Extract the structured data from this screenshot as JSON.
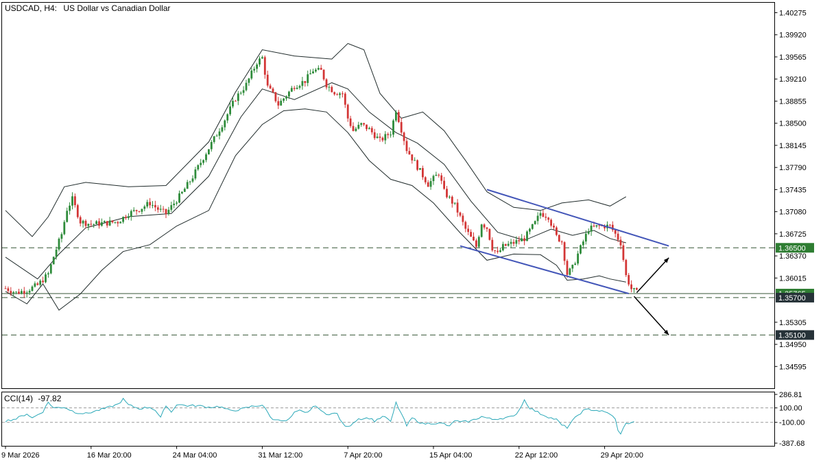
{
  "header": {
    "symbol": "USDCAD, H4:",
    "description": "US Dollar vs Canadian Dollar"
  },
  "colors": {
    "bull": "#2e8b3a",
    "bear": "#d33535",
    "band": "#1f2a2a",
    "channel": "#4255b8",
    "level_line": "#355535",
    "cci": "#2aa8b8",
    "tag_green": "#2e7d32",
    "tag_dark": "#263238",
    "grid": "#000000"
  },
  "chart_data": [
    {
      "type": "candlestick",
      "title": "USDCAD, H4:  US Dollar vs Canadian Dollar",
      "ylim": [
        1.3424,
        1.4044
      ],
      "y_ticks": [
        "1.40275",
        "1.39920",
        "1.39565",
        "1.39210",
        "1.38855",
        "1.38500",
        "1.38145",
        "1.37790",
        "1.37435",
        "1.37080",
        "1.36725",
        "1.36370",
        "1.36015",
        "1.35305",
        "1.34950",
        "1.34595"
      ],
      "x_ticks": [
        {
          "label": "9 Mar 2026",
          "index": 0
        },
        {
          "label": "16 Mar 20:00",
          "index": 32
        },
        {
          "label": "24 Mar 04:00",
          "index": 64
        },
        {
          "label": "31 Mar 12:00",
          "index": 96
        },
        {
          "label": "7 Apr 20:00",
          "index": 128
        },
        {
          "label": "15 Apr 04:00",
          "index": 160
        },
        {
          "label": "22 Apr 12:00",
          "index": 192
        },
        {
          "label": "29 Apr 20:00",
          "index": 224
        }
      ],
      "anchors": [
        [
          0,
          1.3585
        ],
        [
          4,
          1.3578
        ],
        [
          8,
          1.3582
        ],
        [
          12,
          1.359
        ],
        [
          16,
          1.3608
        ],
        [
          18,
          1.3636
        ],
        [
          21,
          1.3672
        ],
        [
          23,
          1.3712
        ],
        [
          25,
          1.3728
        ],
        [
          28,
          1.3692
        ],
        [
          32,
          1.3688
        ],
        [
          38,
          1.369
        ],
        [
          42,
          1.3692
        ],
        [
          46,
          1.3705
        ],
        [
          50,
          1.3712
        ],
        [
          54,
          1.3722
        ],
        [
          57,
          1.3712
        ],
        [
          60,
          1.3705
        ],
        [
          62,
          1.3716
        ],
        [
          66,
          1.3738
        ],
        [
          70,
          1.3764
        ],
        [
          74,
          1.3795
        ],
        [
          78,
          1.3825
        ],
        [
          82,
          1.3856
        ],
        [
          86,
          1.389
        ],
        [
          90,
          1.3912
        ],
        [
          94,
          1.3948
        ],
        [
          96,
          1.3955
        ],
        [
          98,
          1.3908
        ],
        [
          100,
          1.3896
        ],
        [
          102,
          1.388
        ],
        [
          105,
          1.3895
        ],
        [
          108,
          1.391
        ],
        [
          112,
          1.3918
        ],
        [
          115,
          1.3935
        ],
        [
          118,
          1.3934
        ],
        [
          120,
          1.3912
        ],
        [
          123,
          1.39
        ],
        [
          126,
          1.3898
        ],
        [
          128,
          1.3858
        ],
        [
          130,
          1.3838
        ],
        [
          133,
          1.3848
        ],
        [
          136,
          1.384
        ],
        [
          140,
          1.3822
        ],
        [
          144,
          1.3835
        ],
        [
          146,
          1.3872
        ],
        [
          148,
          1.384
        ],
        [
          150,
          1.3808
        ],
        [
          154,
          1.378
        ],
        [
          158,
          1.3752
        ],
        [
          162,
          1.377
        ],
        [
          164,
          1.374
        ],
        [
          168,
          1.3718
        ],
        [
          172,
          1.368
        ],
        [
          176,
          1.3652
        ],
        [
          178,
          1.369
        ],
        [
          180,
          1.3682
        ],
        [
          182,
          1.365
        ],
        [
          184,
          1.364
        ],
        [
          186,
          1.3652
        ],
        [
          190,
          1.3658
        ],
        [
          194,
          1.3665
        ],
        [
          198,
          1.369
        ],
        [
          200,
          1.3706
        ],
        [
          203,
          1.37
        ],
        [
          206,
          1.3668
        ],
        [
          208,
          1.366
        ],
        [
          210,
          1.3608
        ],
        [
          212,
          1.3618
        ],
        [
          214,
          1.364
        ],
        [
          216,
          1.366
        ],
        [
          218,
          1.368
        ],
        [
          222,
          1.3685
        ],
        [
          226,
          1.3685
        ],
        [
          228,
          1.3672
        ],
        [
          230,
          1.3658
        ],
        [
          232,
          1.3605
        ],
        [
          234,
          1.3584
        ],
        [
          236,
          1.3578
        ]
      ],
      "bollinger": {
        "upper": [
          [
            0,
            1.371
          ],
          [
            10,
            1.3668
          ],
          [
            16,
            1.37
          ],
          [
            22,
            1.3748
          ],
          [
            30,
            1.3755
          ],
          [
            46,
            1.3748
          ],
          [
            60,
            1.375
          ],
          [
            76,
            1.382
          ],
          [
            86,
            1.39
          ],
          [
            96,
            1.3968
          ],
          [
            108,
            1.3958
          ],
          [
            122,
            1.3953
          ],
          [
            128,
            1.3978
          ],
          [
            134,
            1.3968
          ],
          [
            140,
            1.3898
          ],
          [
            148,
            1.3858
          ],
          [
            156,
            1.3868
          ],
          [
            164,
            1.3838
          ],
          [
            172,
            1.379
          ],
          [
            180,
            1.374
          ],
          [
            190,
            1.3715
          ],
          [
            200,
            1.371
          ],
          [
            208,
            1.3722
          ],
          [
            218,
            1.3727
          ],
          [
            226,
            1.3717
          ],
          [
            232,
            1.3732
          ]
        ],
        "middle": [
          [
            0,
            1.3635
          ],
          [
            12,
            1.36
          ],
          [
            20,
            1.364
          ],
          [
            30,
            1.3682
          ],
          [
            46,
            1.37
          ],
          [
            62,
            1.3705
          ],
          [
            76,
            1.3765
          ],
          [
            88,
            1.386
          ],
          [
            96,
            1.3905
          ],
          [
            108,
            1.3888
          ],
          [
            122,
            1.3915
          ],
          [
            128,
            1.3905
          ],
          [
            136,
            1.3868
          ],
          [
            146,
            1.3835
          ],
          [
            154,
            1.3818
          ],
          [
            164,
            1.3784
          ],
          [
            174,
            1.3725
          ],
          [
            184,
            1.3675
          ],
          [
            194,
            1.3662
          ],
          [
            204,
            1.368
          ],
          [
            212,
            1.367
          ],
          [
            220,
            1.3678
          ],
          [
            226,
            1.3665
          ],
          [
            232,
            1.3658
          ]
        ],
        "lower": [
          [
            0,
            1.358
          ],
          [
            8,
            1.356
          ],
          [
            14,
            1.3592
          ],
          [
            20,
            1.355
          ],
          [
            28,
            1.3576
          ],
          [
            36,
            1.3614
          ],
          [
            44,
            1.3644
          ],
          [
            54,
            1.3655
          ],
          [
            64,
            1.3685
          ],
          [
            76,
            1.371
          ],
          [
            86,
            1.3798
          ],
          [
            96,
            1.3848
          ],
          [
            104,
            1.387
          ],
          [
            112,
            1.3873
          ],
          [
            120,
            1.3868
          ],
          [
            128,
            1.3835
          ],
          [
            136,
            1.379
          ],
          [
            144,
            1.376
          ],
          [
            152,
            1.375
          ],
          [
            160,
            1.3722
          ],
          [
            170,
            1.3674
          ],
          [
            180,
            1.363
          ],
          [
            190,
            1.364
          ],
          [
            200,
            1.3639
          ],
          [
            206,
            1.3622
          ],
          [
            210,
            1.3598
          ],
          [
            216,
            1.36
          ],
          [
            222,
            1.3605
          ],
          [
            226,
            1.36
          ],
          [
            232,
            1.3595
          ]
        ]
      },
      "channel": {
        "upper": [
          [
            180,
            1.37435
          ],
          [
            248,
            1.3653
          ]
        ],
        "lower": [
          [
            170,
            1.3653
          ],
          [
            233,
            1.35765
          ]
        ]
      },
      "price_lines": [
        {
          "price": 1.365,
          "label": "1.36500",
          "style": "dashed",
          "tag": "tag_green"
        },
        {
          "price": 1.35765,
          "label": "1.35765",
          "style": "solid",
          "tag": "tag_green"
        },
        {
          "price": 1.357,
          "label": "1.35700",
          "style": "dashed",
          "tag": "tag_dark"
        },
        {
          "price": 1.351,
          "label": "1.35100",
          "style": "dashed",
          "tag": "tag_dark"
        }
      ],
      "arrows": [
        {
          "from": [
            236,
            1.3578
          ],
          "to": [
            248,
            1.3634
          ]
        },
        {
          "from": [
            235,
            1.3572
          ],
          "to": [
            248,
            1.351
          ]
        }
      ]
    },
    {
      "type": "line",
      "title": "CCI(14) -97.82",
      "indicator_label": "CCI(14)",
      "current_value": "-97.82",
      "ylim": [
        -430,
        320
      ],
      "y_ticks": [
        "286.81",
        "100.00",
        "-100.00",
        "-387.68"
      ],
      "levels": [
        100,
        -100
      ],
      "anchors": [
        [
          0,
          -80
        ],
        [
          4,
          -50
        ],
        [
          8,
          20
        ],
        [
          10,
          -40
        ],
        [
          14,
          50
        ],
        [
          16,
          180
        ],
        [
          18,
          100
        ],
        [
          22,
          110
        ],
        [
          26,
          40
        ],
        [
          30,
          20
        ],
        [
          34,
          60
        ],
        [
          38,
          100
        ],
        [
          42,
          150
        ],
        [
          44,
          220
        ],
        [
          46,
          140
        ],
        [
          50,
          90
        ],
        [
          54,
          110
        ],
        [
          56,
          70
        ],
        [
          58,
          -40
        ],
        [
          60,
          140
        ],
        [
          62,
          40
        ],
        [
          64,
          150
        ],
        [
          68,
          130
        ],
        [
          72,
          130
        ],
        [
          76,
          110
        ],
        [
          80,
          120
        ],
        [
          84,
          60
        ],
        [
          88,
          80
        ],
        [
          92,
          120
        ],
        [
          96,
          140
        ],
        [
          98,
          40
        ],
        [
          100,
          -70
        ],
        [
          102,
          -50
        ],
        [
          104,
          -90
        ],
        [
          106,
          -60
        ],
        [
          108,
          30
        ],
        [
          110,
          60
        ],
        [
          112,
          30
        ],
        [
          114,
          70
        ],
        [
          116,
          140
        ],
        [
          118,
          50
        ],
        [
          120,
          20
        ],
        [
          124,
          20
        ],
        [
          126,
          -120
        ],
        [
          128,
          -170
        ],
        [
          130,
          -100
        ],
        [
          132,
          -50
        ],
        [
          136,
          -40
        ],
        [
          138,
          -80
        ],
        [
          140,
          -40
        ],
        [
          142,
          -20
        ],
        [
          144,
          -100
        ],
        [
          146,
          170
        ],
        [
          148,
          20
        ],
        [
          150,
          -150
        ],
        [
          152,
          -40
        ],
        [
          156,
          -120
        ],
        [
          160,
          -110
        ],
        [
          164,
          -120
        ],
        [
          166,
          -160
        ],
        [
          168,
          -70
        ],
        [
          170,
          -100
        ],
        [
          174,
          -80
        ],
        [
          178,
          -20
        ],
        [
          182,
          -60
        ],
        [
          186,
          -40
        ],
        [
          190,
          -20
        ],
        [
          192,
          70
        ],
        [
          194,
          210
        ],
        [
          196,
          100
        ],
        [
          198,
          60
        ],
        [
          200,
          20
        ],
        [
          204,
          -40
        ],
        [
          206,
          -60
        ],
        [
          208,
          -140
        ],
        [
          210,
          -170
        ],
        [
          212,
          -80
        ],
        [
          214,
          0
        ],
        [
          216,
          60
        ],
        [
          218,
          80
        ],
        [
          222,
          60
        ],
        [
          226,
          20
        ],
        [
          228,
          -60
        ],
        [
          229,
          -220
        ],
        [
          230,
          -250
        ],
        [
          232,
          -120
        ],
        [
          234,
          -100
        ],
        [
          235,
          -97.82
        ]
      ]
    }
  ]
}
